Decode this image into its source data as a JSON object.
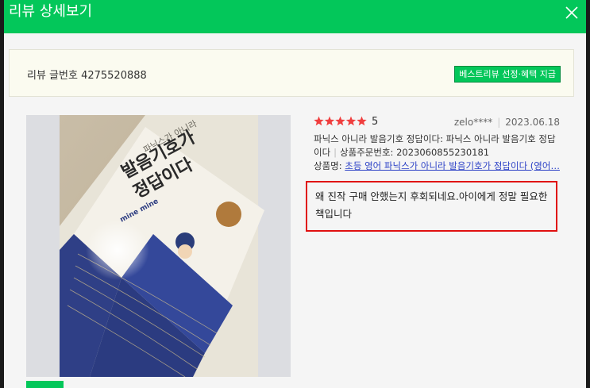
{
  "window": {
    "title": "리뷰 상세보기"
  },
  "info": {
    "review_number_label": "리뷰 글번호",
    "review_number": "4275520888",
    "best_review_button": "베스트리뷰 선정·혜택 지급"
  },
  "review": {
    "rating": "5",
    "star_count": 5,
    "star_color": "#f03e3e",
    "user": "zelo****",
    "date": "2023.06.18",
    "product_option": "파닉스 아니라 발음기호 정답이다: 파닉스 아니라 발음기호 정답이다",
    "order_number_label": "상품주문번호:",
    "order_number": "2023060855230181",
    "product_name_label": "상품명:",
    "product_name": "초등 영어 파닉스가 아니라 발음기호가 정답이다 (영어…",
    "text": "왜 진작 구매 안했는지 후회되네요.아이에게 정말 필요한 책입니다"
  },
  "photo": {
    "book_title_top": "파닉스가 아니라",
    "book_title_main_1": "발음기호가",
    "book_title_main_2": "정답이다",
    "book_subtitle": "mine mine"
  },
  "colors": {
    "accent": "#03c75a",
    "highlight_border": "#e01010",
    "link": "#2c41c6"
  }
}
